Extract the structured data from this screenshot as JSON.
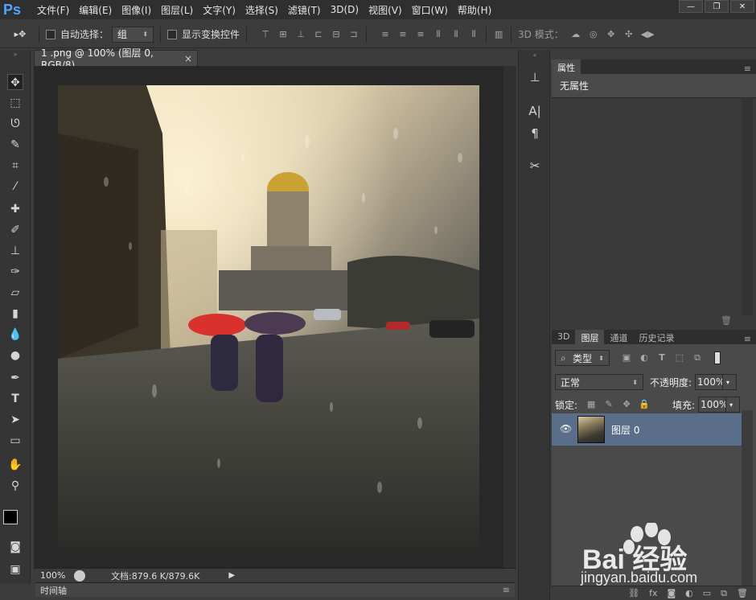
{
  "app": {
    "logo": "Ps"
  },
  "menu": [
    "文件(F)",
    "编辑(E)",
    "图像(I)",
    "图层(L)",
    "文字(Y)",
    "选择(S)",
    "滤镜(T)",
    "3D(D)",
    "视图(V)",
    "窗口(W)",
    "帮助(H)"
  ],
  "window_controls": {
    "minimize": "—",
    "maximize": "❐",
    "close": "✕"
  },
  "options": {
    "auto_select_label": "自动选择：",
    "auto_select_value": "组",
    "show_transform_label": "显示变换控件",
    "mode_3d_label": "3D 模式："
  },
  "document": {
    "tab_title": "1 .png @ 100% (图层 0, RGB/8)",
    "tab_close": "×",
    "zoom": "100%",
    "doc_size": "文档:879.6 K/879.6K"
  },
  "timeline": {
    "label": "时间轴"
  },
  "properties": {
    "tab_label": "属性",
    "body_text": "无属性"
  },
  "layers_panel": {
    "tabs": [
      "3D",
      "图层",
      "通道",
      "历史记录"
    ],
    "active_tab": "图层",
    "filter_label": "类型",
    "blend_mode": "正常",
    "opacity_label": "不透明度:",
    "opacity_value": "100%",
    "lock_label": "锁定:",
    "fill_label": "填充:",
    "fill_value": "100%",
    "layer_name": "图层 0",
    "footer_icons": [
      "link-icon",
      "fx-icon",
      "mask-icon",
      "adjustment-icon",
      "group-icon",
      "new-layer-icon",
      "trash-icon"
    ],
    "footer_glyphs": [
      "⛓",
      "fx",
      "◙",
      "◐",
      "▭",
      "⧉",
      "🗑"
    ]
  },
  "watermark": {
    "brand": "Bai  经验",
    "url": "jingyan.baidu.com"
  },
  "colors": {
    "selected_layer": "#5a6e8a",
    "ps_blue": "#4fa7ff"
  }
}
